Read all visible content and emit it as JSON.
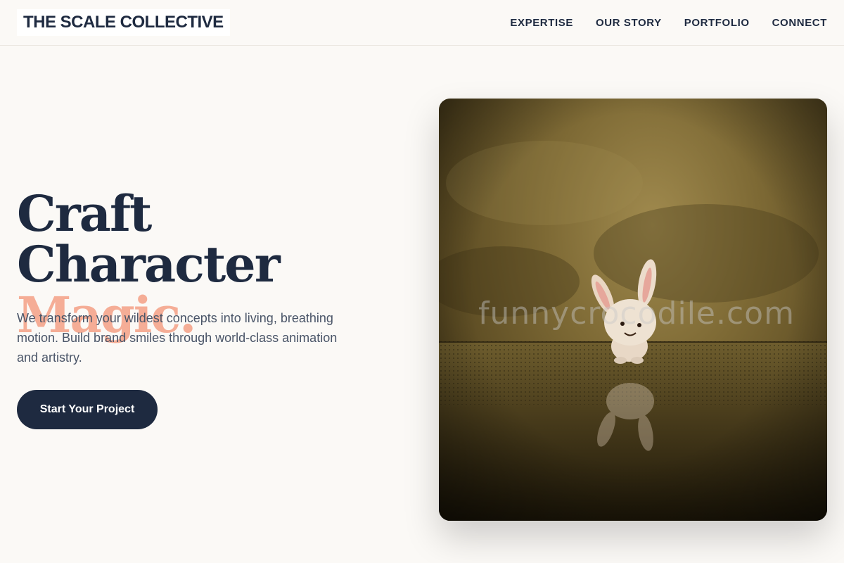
{
  "header": {
    "brand": "THE SCALE COLLECTIVE",
    "nav": [
      {
        "label": "EXPERTISE"
      },
      {
        "label": "OUR STORY"
      },
      {
        "label": "PORTFOLIO"
      },
      {
        "label": "CONNECT"
      }
    ]
  },
  "hero": {
    "title_line1": "Craft Character",
    "title_line2": "Magic.",
    "description": "We transform your wildest concepts into living, breathing motion. Build brand smiles through world-class animation and artistry.",
    "cta_label": "Start Your Project",
    "image": {
      "subject": "bunny-figurine-photo",
      "watermark": "funnycrocodile.com"
    }
  },
  "colors": {
    "background": "#fbf9f6",
    "navy": "#1e2a40",
    "accent_peach": "#f5ad96",
    "text_muted": "#4a5568"
  }
}
